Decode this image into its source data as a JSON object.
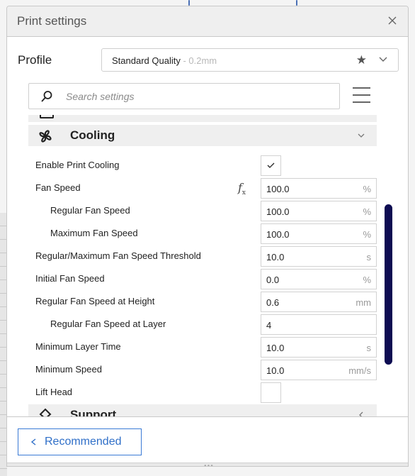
{
  "window": {
    "title": "Print settings",
    "close_icon": "close-icon"
  },
  "profile": {
    "label": "Profile",
    "selected_name": "Standard Quality",
    "selected_sub": " - 0.2mm",
    "favorite_icon": "star-icon",
    "dropdown_icon": "chevron-down-icon"
  },
  "search": {
    "placeholder": "Search settings",
    "icon": "search-icon"
  },
  "settings_menu_icon": "hamburger-menu-icon",
  "categories": {
    "cooling": {
      "label": "Cooling",
      "icon": "fan-icon",
      "expanded": true
    },
    "support": {
      "label": "Support",
      "icon": "support-icon",
      "expanded": false
    }
  },
  "settings": [
    {
      "label": "Enable Print Cooling",
      "type": "checkbox",
      "checked": true,
      "indent": 0
    },
    {
      "label": "Fan Speed",
      "type": "number",
      "value": "100.0",
      "unit": "%",
      "indent": 0,
      "has_function": true
    },
    {
      "label": "Regular Fan Speed",
      "type": "number",
      "value": "100.0",
      "unit": "%",
      "indent": 1
    },
    {
      "label": "Maximum Fan Speed",
      "type": "number",
      "value": "100.0",
      "unit": "%",
      "indent": 1
    },
    {
      "label": "Regular/Maximum Fan Speed Threshold",
      "type": "number",
      "value": "10.0",
      "unit": "s",
      "indent": 0
    },
    {
      "label": "Initial Fan Speed",
      "type": "number",
      "value": "0.0",
      "unit": "%",
      "indent": 0
    },
    {
      "label": "Regular Fan Speed at Height",
      "type": "number",
      "value": "0.6",
      "unit": "mm",
      "indent": 0
    },
    {
      "label": "Regular Fan Speed at Layer",
      "type": "number",
      "value": "4",
      "unit": "",
      "indent": 1
    },
    {
      "label": "Minimum Layer Time",
      "type": "number",
      "value": "10.0",
      "unit": "s",
      "indent": 0
    },
    {
      "label": "Minimum Speed",
      "type": "number",
      "value": "10.0",
      "unit": "mm/s",
      "indent": 0
    },
    {
      "label": "Lift Head",
      "type": "checkbox",
      "checked": false,
      "indent": 0
    }
  ],
  "fx_label": "f",
  "fx_sub": "x",
  "footer": {
    "recommended_label": "Recommended"
  },
  "colors": {
    "accent": "#2f6fc8",
    "scrollbar": "#0d0c52",
    "header_bg": "#efefef"
  }
}
